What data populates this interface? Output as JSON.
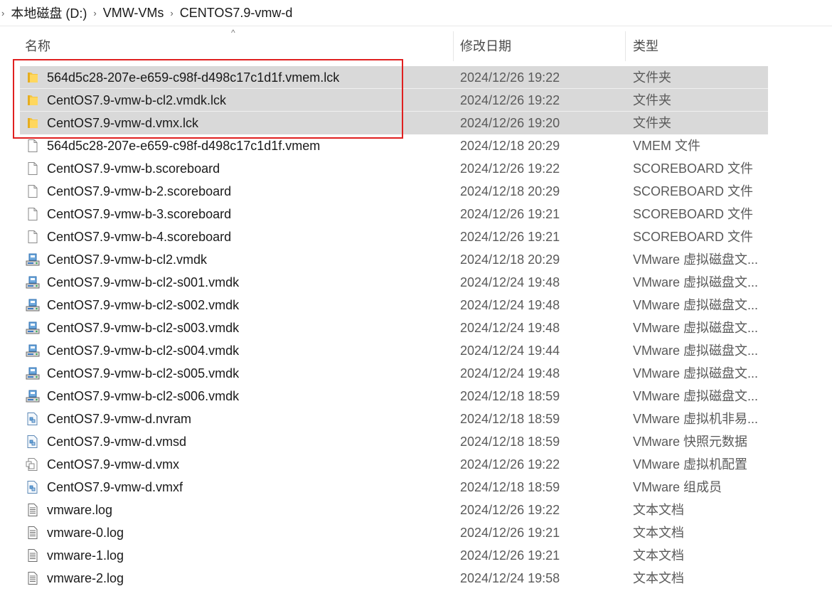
{
  "breadcrumb": {
    "items": [
      "本地磁盘 (D:)",
      "VMW-VMs",
      "CENTOS7.9-vmw-d"
    ],
    "separator": "›"
  },
  "columns": {
    "name": "名称",
    "date": "修改日期",
    "type": "类型",
    "sort_indicator": "^"
  },
  "colors": {
    "selection": "#d9d9d9",
    "highlight_border": "#e02020",
    "folder": "#f4c542"
  },
  "files": [
    {
      "name": "564d5c28-207e-e659-c98f-d498c17c1d1f.vmem.lck",
      "date": "2024/12/26 19:22",
      "type": "文件夹",
      "icon": "folder-icon",
      "selected": true
    },
    {
      "name": "CentOS7.9-vmw-b-cl2.vmdk.lck",
      "date": "2024/12/26 19:22",
      "type": "文件夹",
      "icon": "folder-icon",
      "selected": true
    },
    {
      "name": "CentOS7.9-vmw-d.vmx.lck",
      "date": "2024/12/26 19:20",
      "type": "文件夹",
      "icon": "folder-icon",
      "selected": true
    },
    {
      "name": "564d5c28-207e-e659-c98f-d498c17c1d1f.vmem",
      "date": "2024/12/18 20:29",
      "type": "VMEM 文件",
      "icon": "file-icon",
      "selected": false
    },
    {
      "name": "CentOS7.9-vmw-b.scoreboard",
      "date": "2024/12/26 19:22",
      "type": "SCOREBOARD 文件",
      "icon": "file-icon",
      "selected": false
    },
    {
      "name": "CentOS7.9-vmw-b-2.scoreboard",
      "date": "2024/12/18 20:29",
      "type": "SCOREBOARD 文件",
      "icon": "file-icon",
      "selected": false
    },
    {
      "name": "CentOS7.9-vmw-b-3.scoreboard",
      "date": "2024/12/26 19:21",
      "type": "SCOREBOARD 文件",
      "icon": "file-icon",
      "selected": false
    },
    {
      "name": "CentOS7.9-vmw-b-4.scoreboard",
      "date": "2024/12/26 19:21",
      "type": "SCOREBOARD 文件",
      "icon": "file-icon",
      "selected": false
    },
    {
      "name": "CentOS7.9-vmw-b-cl2.vmdk",
      "date": "2024/12/18 20:29",
      "type": "VMware 虚拟磁盘文...",
      "icon": "vmdk-icon",
      "selected": false
    },
    {
      "name": "CentOS7.9-vmw-b-cl2-s001.vmdk",
      "date": "2024/12/24 19:48",
      "type": "VMware 虚拟磁盘文...",
      "icon": "vmdk-icon",
      "selected": false
    },
    {
      "name": "CentOS7.9-vmw-b-cl2-s002.vmdk",
      "date": "2024/12/24 19:48",
      "type": "VMware 虚拟磁盘文...",
      "icon": "vmdk-icon",
      "selected": false
    },
    {
      "name": "CentOS7.9-vmw-b-cl2-s003.vmdk",
      "date": "2024/12/24 19:48",
      "type": "VMware 虚拟磁盘文...",
      "icon": "vmdk-icon",
      "selected": false
    },
    {
      "name": "CentOS7.9-vmw-b-cl2-s004.vmdk",
      "date": "2024/12/24 19:44",
      "type": "VMware 虚拟磁盘文...",
      "icon": "vmdk-icon",
      "selected": false
    },
    {
      "name": "CentOS7.9-vmw-b-cl2-s005.vmdk",
      "date": "2024/12/24 19:48",
      "type": "VMware 虚拟磁盘文...",
      "icon": "vmdk-icon",
      "selected": false
    },
    {
      "name": "CentOS7.9-vmw-b-cl2-s006.vmdk",
      "date": "2024/12/18 18:59",
      "type": "VMware 虚拟磁盘文...",
      "icon": "vmdk-icon",
      "selected": false
    },
    {
      "name": "CentOS7.9-vmw-d.nvram",
      "date": "2024/12/18 18:59",
      "type": "VMware 虚拟机非易...",
      "icon": "vmware-file-icon",
      "selected": false
    },
    {
      "name": "CentOS7.9-vmw-d.vmsd",
      "date": "2024/12/18 18:59",
      "type": "VMware 快照元数据",
      "icon": "vmware-file-icon",
      "selected": false
    },
    {
      "name": "CentOS7.9-vmw-d.vmx",
      "date": "2024/12/26 19:22",
      "type": "VMware 虚拟机配置",
      "icon": "vmx-icon",
      "selected": false
    },
    {
      "name": "CentOS7.9-vmw-d.vmxf",
      "date": "2024/12/18 18:59",
      "type": "VMware 组成员",
      "icon": "vmware-file-icon",
      "selected": false
    },
    {
      "name": "vmware.log",
      "date": "2024/12/26 19:22",
      "type": "文本文档",
      "icon": "text-file-icon",
      "selected": false
    },
    {
      "name": "vmware-0.log",
      "date": "2024/12/26 19:21",
      "type": "文本文档",
      "icon": "text-file-icon",
      "selected": false
    },
    {
      "name": "vmware-1.log",
      "date": "2024/12/26 19:21",
      "type": "文本文档",
      "icon": "text-file-icon",
      "selected": false
    },
    {
      "name": "vmware-2.log",
      "date": "2024/12/24 19:58",
      "type": "文本文档",
      "icon": "text-file-icon",
      "selected": false
    }
  ]
}
